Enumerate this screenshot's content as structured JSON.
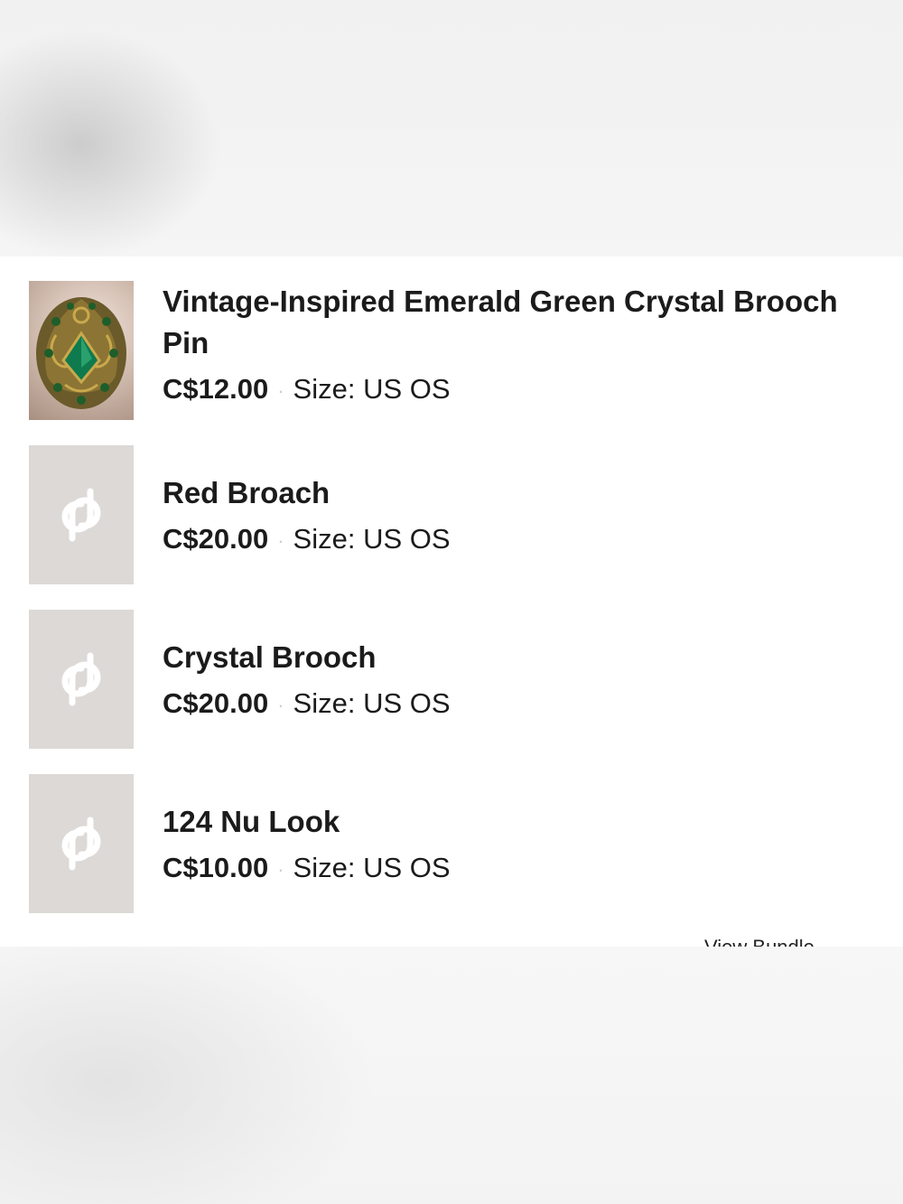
{
  "listings": [
    {
      "title": "Vintage-Inspired Emerald Green Crystal Brooch Pin",
      "price": "C$12.00",
      "separator": "·",
      "size": "Size: US OS",
      "thumbnail": "emerald-brooch-photo"
    },
    {
      "title": "Red Broach",
      "price": "C$20.00",
      "separator": "·",
      "size": "Size: US OS",
      "thumbnail": "poshmark-logo-icon"
    },
    {
      "title": "Crystal Brooch",
      "price": "C$20.00",
      "separator": "·",
      "size": "Size: US OS",
      "thumbnail": "poshmark-logo-icon"
    },
    {
      "title": "124 Nu Look",
      "price": "C$10.00",
      "separator": "·",
      "size": "Size: US OS",
      "thumbnail": "poshmark-logo-icon"
    }
  ],
  "view_all_label": "View Bundle",
  "colors": {
    "placeholder_bg": "#dcd9d7",
    "text": "#1b1b1b",
    "separator": "#cfcfcf"
  }
}
